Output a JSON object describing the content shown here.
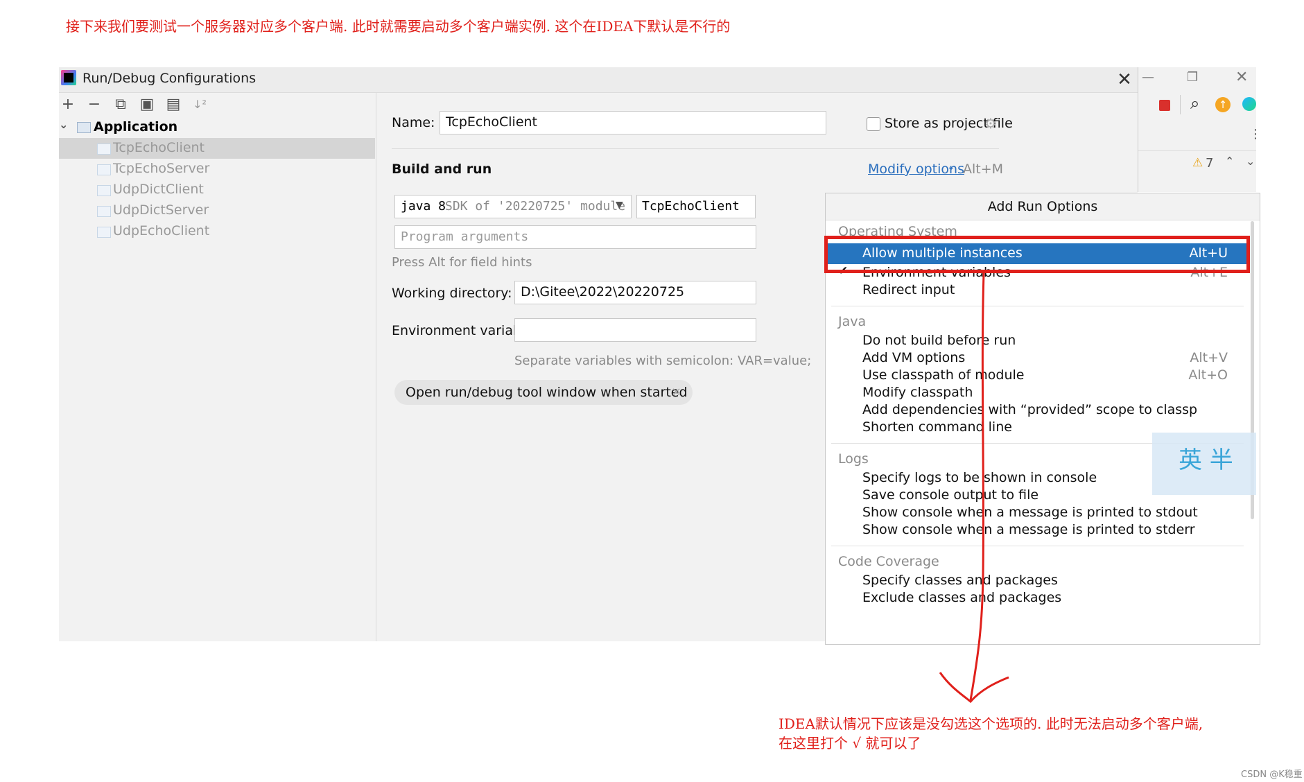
{
  "annotations": {
    "top_note": "接下来我们要测试一个服务器对应多个客户端. 此时就需要启动多个客户端实例. 这个在IDEA下默认是不行的",
    "bottom_note_line1": "IDEA默认情况下应该是没勾选这个选项的. 此时无法启动多个客户端,",
    "bottom_note_line2": "在这里打个 √ 就可以了",
    "watermark": "CSDN @K稳重",
    "ime_badge": "英 半"
  },
  "colors": {
    "annotation_red": "#e0201b",
    "highlight_blue": "#2675bf",
    "link_blue": "#2a6ebd"
  },
  "dialog": {
    "title": "Run/Debug Configurations",
    "close_icon": "close-icon",
    "toolbar_icons": [
      "add-icon",
      "remove-icon",
      "copy-icon",
      "save-icon",
      "folder-icon",
      "sort-icon"
    ],
    "toolbar_glyphs": [
      "+",
      "−",
      "⧉",
      "▣",
      "▤",
      "↓²"
    ],
    "tree": {
      "root": "Application",
      "items": [
        "TcpEchoClient",
        "TcpEchoServer",
        "UdpDictClient",
        "UdpDictServer",
        "UdpEchoClient"
      ],
      "selected_index": 0
    },
    "form": {
      "name_label": "Name:",
      "name_value": "TcpEchoClient",
      "store_as_project_file": "Store as project file",
      "store_checked": false,
      "build_and_run": "Build and run",
      "modify_options": "Modify options",
      "modify_shortcut": "Alt+M",
      "sdk_java": "java 8",
      "sdk_detail": "SDK of '20220725' module",
      "main_class": "TcpEchoClient",
      "program_arguments_placeholder": "Program arguments",
      "field_hint": "Press Alt for field hints",
      "working_directory_label": "Working directory:",
      "working_directory_value": "D:\\Gitee\\2022\\20220725",
      "env_vars_label": "Environment variables:",
      "env_vars_value": "",
      "env_vars_hint": "Separate variables with semicolon: VAR=value;",
      "chip_label": "Open run/debug tool window when started",
      "chip_close": "×"
    }
  },
  "ide_background": {
    "warnings_count": "7"
  },
  "popup": {
    "title": "Add Run Options",
    "sections": [
      {
        "name": "Operating System",
        "options": [
          {
            "label": "Allow multiple instances",
            "shortcut": "Alt+U",
            "highlighted": true,
            "checked": false
          },
          {
            "label": "Environment variables",
            "shortcut": "Alt+E",
            "highlighted": false,
            "checked": true
          },
          {
            "label": "Redirect input",
            "shortcut": "",
            "highlighted": false,
            "checked": false
          }
        ]
      },
      {
        "name": "Java",
        "options": [
          {
            "label": "Do not build before run",
            "shortcut": ""
          },
          {
            "label": "Add VM options",
            "shortcut": "Alt+V"
          },
          {
            "label": "Use classpath of module",
            "shortcut": "Alt+O"
          },
          {
            "label": "Modify classpath",
            "shortcut": ""
          },
          {
            "label": "Add dependencies with “provided” scope to classp",
            "shortcut": ""
          },
          {
            "label": "Shorten command line",
            "shortcut": ""
          }
        ]
      },
      {
        "name": "Logs",
        "options": [
          {
            "label": "Specify logs to be shown in console",
            "shortcut": ""
          },
          {
            "label": "Save console output to file",
            "shortcut": ""
          },
          {
            "label": "Show console when a message is printed to stdout",
            "shortcut": ""
          },
          {
            "label": "Show console when a message is printed to stderr",
            "shortcut": ""
          }
        ]
      },
      {
        "name": "Code Coverage",
        "options": [
          {
            "label": "Specify classes and packages",
            "shortcut": ""
          },
          {
            "label": "Exclude classes and packages",
            "shortcut": ""
          }
        ]
      }
    ]
  }
}
